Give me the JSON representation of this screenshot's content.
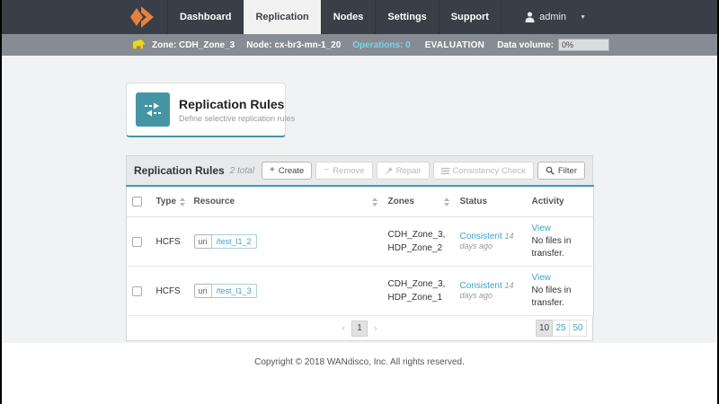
{
  "colors": {
    "nav_bg": "#393e47",
    "zonebar_bg": "#868b94",
    "teal_accent": "#4496a5",
    "link_blue": "#39a5c8",
    "operations_cyan": "#7fd4e6",
    "logo_orange": "#e8813c",
    "elephant_yellow": "#efd424"
  },
  "topnav": {
    "tabs": [
      {
        "label": "Dashboard"
      },
      {
        "label": "Replication"
      },
      {
        "label": "Nodes"
      },
      {
        "label": "Settings"
      },
      {
        "label": "Support"
      }
    ],
    "user": "admin"
  },
  "zonebar": {
    "zone": "Zone: CDH_Zone_3",
    "node": "Node: cx-br3-mn-1_20",
    "operations": "Operations: 0",
    "license": "EVALUATION",
    "data_volume_label": "Data volume:",
    "data_volume_value": "0%"
  },
  "page_header": {
    "title": "Replication Rules",
    "subtitle": "Define selective replication rules"
  },
  "panel": {
    "title": "Replication Rules",
    "total": "2 total",
    "buttons": {
      "create": "Create",
      "remove": "Remove",
      "repair": "Repair",
      "consistency_check": "Consistency Check",
      "filter": "Filter"
    }
  },
  "table": {
    "headers": [
      "Type",
      "Resource",
      "Zones",
      "Status",
      "Activity"
    ],
    "rows": [
      {
        "type": "HCFS",
        "resource_kind": "uri",
        "resource_path": "/test_l1_2",
        "zones_line1": "CDH_Zone_3,",
        "zones_line2": "HDP_Zone_2",
        "status": "Consistent",
        "status_time": "14 days ago",
        "activity_link": "View",
        "activity_note": "No files in transfer."
      },
      {
        "type": "HCFS",
        "resource_kind": "uri",
        "resource_path": "/test_l1_3",
        "zones_line1": "CDH_Zone_3,",
        "zones_line2": "HDP_Zone_1",
        "status": "Consistent",
        "status_time": "14 days ago",
        "activity_link": "View",
        "activity_note": "No files in transfer."
      }
    ]
  },
  "pagination": {
    "prev": "‹",
    "page": "1",
    "next": "›",
    "sizes": [
      "10",
      "25",
      "50"
    ]
  },
  "footer": "Copyright © 2018 WANdisco, Inc. All rights reserved."
}
